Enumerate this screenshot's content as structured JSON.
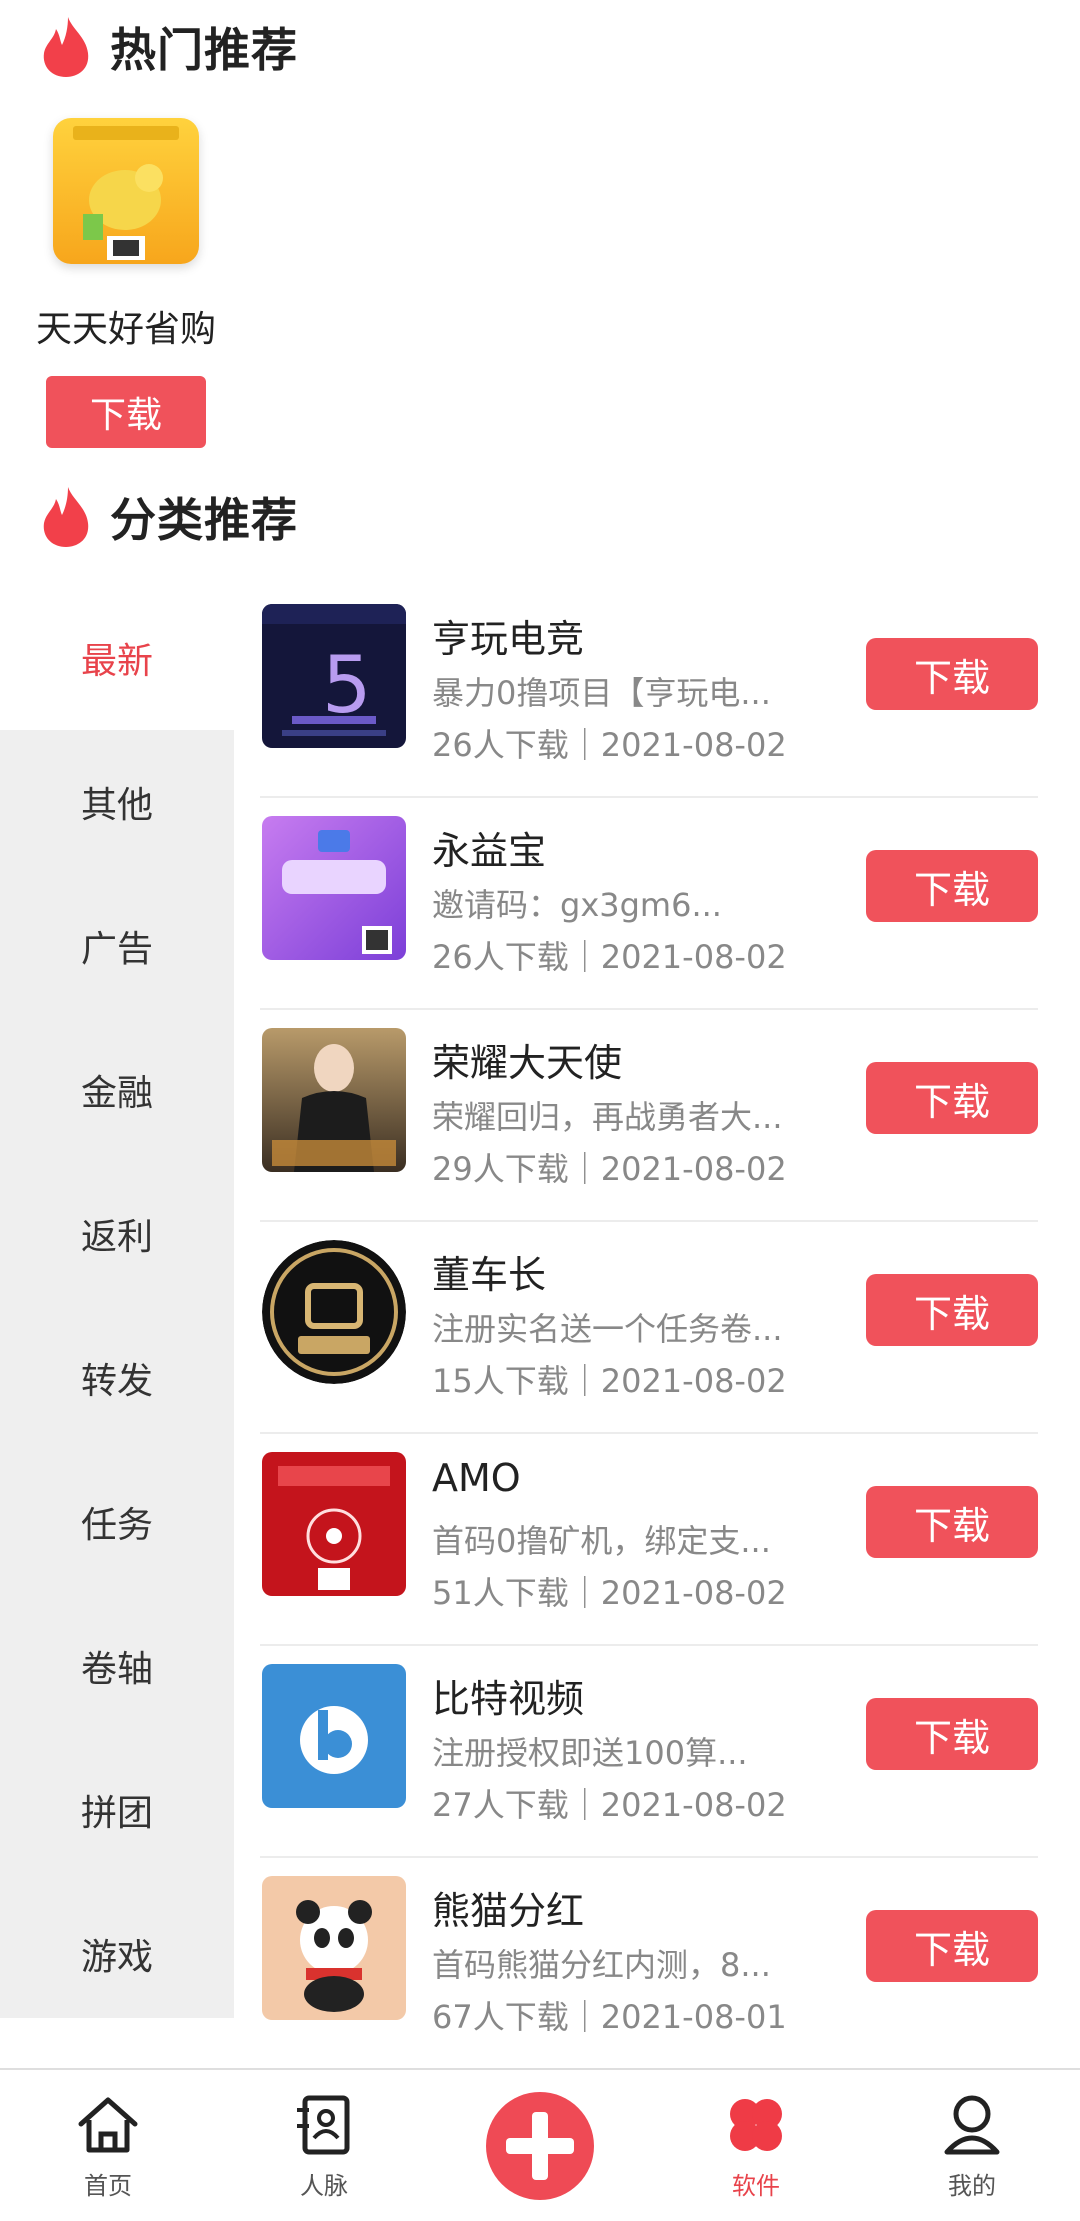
{
  "hot": {
    "title": "热门推荐",
    "app": {
      "name": "天天好省购",
      "button": "下载"
    }
  },
  "category": {
    "title": "分类推荐",
    "tabs": [
      "最新",
      "其他",
      "广告",
      "金融",
      "返利",
      "转发",
      "任务",
      "卷轴",
      "拼团",
      "游戏"
    ],
    "active_tab": "最新"
  },
  "apps": [
    {
      "name": "亨玩电竞",
      "desc": "暴力0撸项目【亨玩电...",
      "meta": "26人下载｜2021-08-02",
      "button": "下载"
    },
    {
      "name": "永益宝",
      "desc": "邀请码：gx3gm6...",
      "meta": "26人下载｜2021-08-02",
      "button": "下载"
    },
    {
      "name": "荣耀大天使",
      "desc": "荣耀回归，再战勇者大...",
      "meta": "29人下载｜2021-08-02",
      "button": "下载"
    },
    {
      "name": "董车长",
      "desc": "注册实名送一个任务卷...",
      "meta": "15人下载｜2021-08-02",
      "button": "下载"
    },
    {
      "name": "AMO",
      "desc": "首码0撸矿机，绑定支...",
      "meta": "51人下载｜2021-08-02",
      "button": "下载"
    },
    {
      "name": "比特视频",
      "desc": "注册授权即送100算...",
      "meta": "27人下载｜2021-08-02",
      "button": "下载"
    },
    {
      "name": "熊猫分红",
      "desc": "首码熊猫分红内测，8...",
      "meta": "67人下载｜2021-08-01",
      "button": "下载"
    }
  ],
  "tabbar": {
    "items": [
      {
        "label": "首页",
        "icon": "home-icon"
      },
      {
        "label": "人脉",
        "icon": "contacts-icon"
      },
      {
        "label": "",
        "icon": "add-icon"
      },
      {
        "label": "软件",
        "icon": "clover-icon"
      },
      {
        "label": "我的",
        "icon": "profile-icon"
      }
    ],
    "active": "软件"
  },
  "colors": {
    "accent": "#f0525b",
    "active_text": "#e8434b",
    "sidebar_bg": "#efefef"
  }
}
